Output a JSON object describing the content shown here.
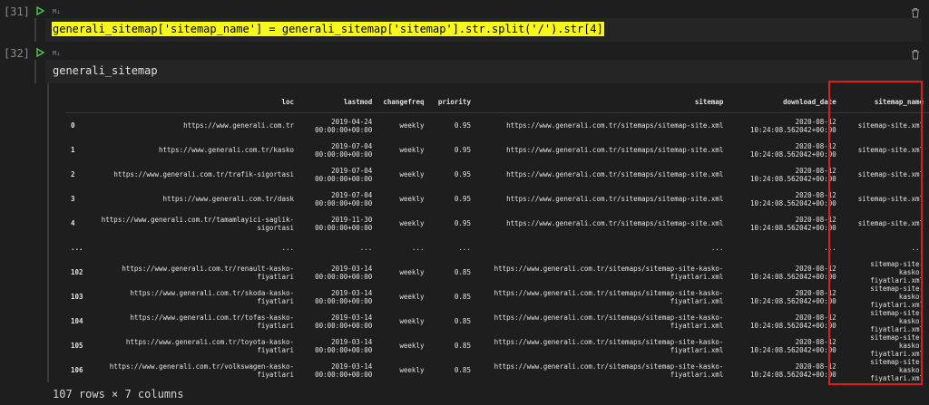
{
  "cells": [
    {
      "exec_count": "[31]",
      "lang": "M↓",
      "code": "generali_sitemap['sitemap_name'] = generali_sitemap['sitemap'].str.split('/').str[4]"
    },
    {
      "exec_count": "[32]",
      "lang": "M↓",
      "code": "generali_sitemap"
    }
  ],
  "table": {
    "columns": [
      "",
      "loc",
      "lastmod",
      "changefreq",
      "priority",
      "sitemap",
      "download_date",
      "sitemap_name"
    ],
    "rows": [
      [
        "0",
        "https://www.generali.com.tr",
        "2019-04-24\n00:00:00+00:00",
        "weekly",
        "0.95",
        "https://www.generali.com.tr/sitemaps/sitemap-site.xml",
        "2020-08-12\n10:24:08.562042+00:00",
        "sitemap-site.xml"
      ],
      [
        "1",
        "https://www.generali.com.tr/kasko",
        "2019-07-04\n00:00:00+00:00",
        "weekly",
        "0.95",
        "https://www.generali.com.tr/sitemaps/sitemap-site.xml",
        "2020-08-12\n10:24:08.562042+00:00",
        "sitemap-site.xml"
      ],
      [
        "2",
        "https://www.generali.com.tr/trafik-sigortasi",
        "2019-07-04\n00:00:00+00:00",
        "weekly",
        "0.95",
        "https://www.generali.com.tr/sitemaps/sitemap-site.xml",
        "2020-08-12\n10:24:08.562042+00:00",
        "sitemap-site.xml"
      ],
      [
        "3",
        "https://www.generali.com.tr/dask",
        "2019-07-04\n00:00:00+00:00",
        "weekly",
        "0.95",
        "https://www.generali.com.tr/sitemaps/sitemap-site.xml",
        "2020-08-12\n10:24:08.562042+00:00",
        "sitemap-site.xml"
      ],
      [
        "4",
        "https://www.generali.com.tr/tamamlayici-saglik-\nsigortasi",
        "2019-11-30\n00:00:00+00:00",
        "weekly",
        "0.95",
        "https://www.generali.com.tr/sitemaps/sitemap-site.xml",
        "2020-08-12\n10:24:08.562042+00:00",
        "sitemap-site.xml"
      ],
      [
        "...",
        "...",
        "...",
        "...",
        "...",
        "...",
        "...",
        "..."
      ],
      [
        "102",
        "https://www.generali.com.tr/renault-kasko-\nfiyatlari",
        "2019-03-14\n00:00:00+00:00",
        "weekly",
        "0.85",
        "https://www.generali.com.tr/sitemaps/sitemap-site-kasko-\nfiyatlari.xml",
        "2020-08-12\n10:24:08.562042+00:00",
        "sitemap-site-kasko-\nfiyatlari.xml"
      ],
      [
        "103",
        "https://www.generali.com.tr/skoda-kasko-\nfiyatlari",
        "2019-03-14\n00:00:00+00:00",
        "weekly",
        "0.85",
        "https://www.generali.com.tr/sitemaps/sitemap-site-kasko-\nfiyatlari.xml",
        "2020-08-12\n10:24:08.562042+00:00",
        "sitemap-site-kasko-\nfiyatlari.xml"
      ],
      [
        "104",
        "https://www.generali.com.tr/tofas-kasko-\nfiyatlari",
        "2019-03-14\n00:00:00+00:00",
        "weekly",
        "0.85",
        "https://www.generali.com.tr/sitemaps/sitemap-site-kasko-\nfiyatlari.xml",
        "2020-08-12\n10:24:08.562042+00:00",
        "sitemap-site-kasko-\nfiyatlari.xml"
      ],
      [
        "105",
        "https://www.generali.com.tr/toyota-kasko-\nfiyatlari",
        "2019-03-14\n00:00:00+00:00",
        "weekly",
        "0.85",
        "https://www.generali.com.tr/sitemaps/sitemap-site-kasko-\nfiyatlari.xml",
        "2020-08-12\n10:24:08.562042+00:00",
        "sitemap-site-kasko-\nfiyatlari.xml"
      ],
      [
        "106",
        "https://www.generali.com.tr/volkswagen-kasko-\nfiyatlari",
        "2019-03-14\n00:00:00+00:00",
        "weekly",
        "0.85",
        "https://www.generali.com.tr/sitemaps/sitemap-site-kasko-\nfiyatlari.xml",
        "2020-08-12\n10:24:08.562042+00:00",
        "sitemap-site-kasko-\nfiyatlari.xml"
      ]
    ]
  },
  "footer": "107 rows × 7 columns",
  "colors": {
    "background": "#1e1e1e",
    "highlight": "#f7f71d",
    "annotation_box": "#e01b1b",
    "run_icon": "#4ec94e"
  },
  "icons": {
    "run": "run-icon",
    "delete": "trash-icon"
  }
}
